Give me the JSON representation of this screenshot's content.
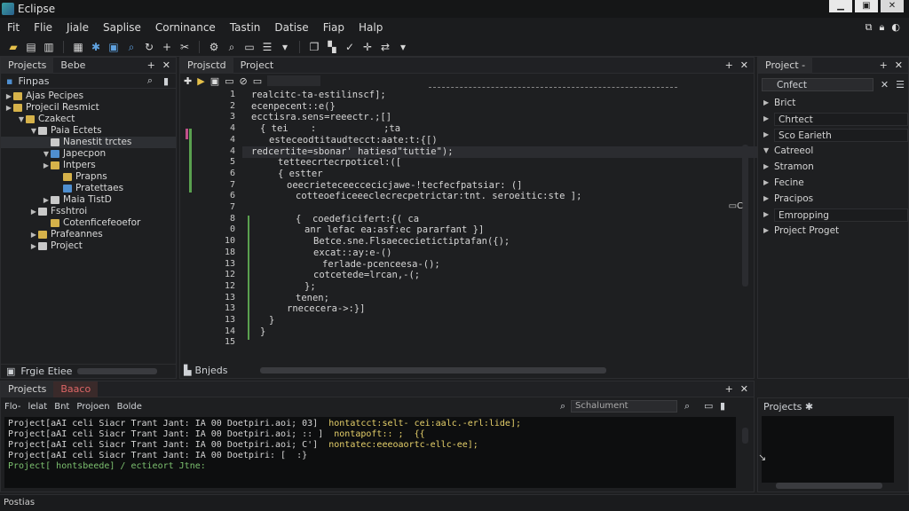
{
  "window": {
    "title": "Eclipse"
  },
  "menu": [
    "Fit",
    "Flie",
    "Jiale",
    "Saplise",
    "Corninance",
    "Tastin",
    "Datise",
    "Fiap",
    "Halp"
  ],
  "toolbar_icons": [
    "new-file-icon",
    "copy-icon",
    "paste-icon",
    "save-icon",
    "debug-icon",
    "run-icon",
    "search-icon",
    "refresh-icon",
    "add-icon",
    "cut-icon",
    "build-icon",
    "find-icon",
    "terminal-icon",
    "menu-icon",
    "window-icon",
    "tile-icon",
    "check-icon",
    "plus-icon",
    "arrows-icon",
    "dropdown-icon"
  ],
  "left_panel": {
    "tab_projects": "Projects",
    "tab_beb": "Bebe",
    "filter_label": "Finpas",
    "tree": [
      {
        "label": "Ajas Pecipes",
        "level": 0,
        "arrow": "▶",
        "icon": "folder",
        "selected": false
      },
      {
        "label": "Projecil Resmict",
        "level": 0,
        "arrow": "▶",
        "icon": "folder",
        "selected": false
      },
      {
        "label": "Czakect",
        "level": 1,
        "arrow": "▼",
        "icon": "folder",
        "selected": false
      },
      {
        "label": "Paia Ectets",
        "level": 2,
        "arrow": "▼",
        "icon": "file",
        "selected": false
      },
      {
        "label": "Nanestit trctes",
        "level": 3,
        "arrow": "",
        "icon": "file",
        "selected": true
      },
      {
        "label": "Japecpon",
        "level": 3,
        "arrow": "▼",
        "icon": "blue",
        "selected": false
      },
      {
        "label": "Intpers",
        "level": 3,
        "arrow": "▶",
        "icon": "folder",
        "selected": false
      },
      {
        "label": "Prapns",
        "level": 4,
        "arrow": "",
        "icon": "folder",
        "selected": false
      },
      {
        "label": "Pratettaes",
        "level": 4,
        "arrow": "",
        "icon": "blue",
        "selected": false
      },
      {
        "label": "Maia TistD",
        "level": 3,
        "arrow": "▶",
        "icon": "file",
        "selected": false
      },
      {
        "label": "Fsshtroi",
        "level": 2,
        "arrow": "▶",
        "icon": "file",
        "selected": false
      },
      {
        "label": "Cotenficefeoefor",
        "level": 3,
        "arrow": "",
        "icon": "folder",
        "selected": false
      },
      {
        "label": "Prafeannes",
        "level": 2,
        "arrow": "▶",
        "icon": "folder",
        "selected": false
      },
      {
        "label": "Project",
        "level": 2,
        "arrow": "▶",
        "icon": "file",
        "selected": false
      }
    ],
    "footer_label": "Frgie Etiee"
  },
  "editor": {
    "tab_active": "Projsctd",
    "tab_other": "Project",
    "lines": [
      {
        "n": "1",
        "text": "realcitc-ta-estilinscf];",
        "hl": false,
        "indent": 0
      },
      {
        "n": "2",
        "text": "ecenpecent::e(}",
        "hl": false,
        "indent": 0
      },
      {
        "n": "3",
        "text": "ecctisra.sens=reeectr.;[]",
        "hl": false,
        "indent": 0
      },
      {
        "n": "4",
        "text": "{ tei    :            ;ta",
        "hl": false,
        "indent": 1
      },
      {
        "n": "4",
        "text": "esteceodtitaudtecct:aate:t:{[)",
        "hl": false,
        "indent": 2
      },
      {
        "n": "4",
        "text": "redcertite=sbonar' hatiesd\"tuttie\");",
        "hl": true,
        "indent": 3
      },
      {
        "n": "5",
        "text": "tetteecrtecrpoticel:([",
        "hl": false,
        "indent": 3
      },
      {
        "n": "6",
        "text": "{ estter",
        "hl": false,
        "indent": 3
      },
      {
        "n": "7",
        "text": "oeecrieteceeccecicjawe-!tecfecfpatsiar: (]",
        "hl": false,
        "indent": 4
      },
      {
        "n": "6",
        "text": "cotteoeficeeeclecrecpetrictar:tnt. seroeitic:ste ];",
        "hl": false,
        "indent": 5
      },
      {
        "n": "7",
        "text": "",
        "hl": false,
        "indent": 0
      },
      {
        "n": "8",
        "text": "{  coedeficifert:{( ca",
        "hl": false,
        "indent": 5
      },
      {
        "n": "0",
        "text": "anr lefac ea:asf:ec pararfant }]",
        "hl": false,
        "indent": 6
      },
      {
        "n": "10",
        "text": "Betce.sne.Flsaececietictiptafan({);",
        "hl": false,
        "indent": 7
      },
      {
        "n": "18",
        "text": "excat::ay:e-()",
        "hl": false,
        "indent": 7
      },
      {
        "n": "13",
        "text": "ferlade-pcenceesa-();",
        "hl": false,
        "indent": 8
      },
      {
        "n": "12",
        "text": "cotcetede=lrcan,-(;",
        "hl": false,
        "indent": 7
      },
      {
        "n": "12",
        "text": "};",
        "hl": false,
        "indent": 6
      },
      {
        "n": "13",
        "text": "tenen;",
        "hl": false,
        "indent": 5
      },
      {
        "n": "13",
        "text": "rnececera->:}]",
        "hl": false,
        "indent": 4
      },
      {
        "n": "13",
        "text": "}",
        "hl": false,
        "indent": 2
      },
      {
        "n": "14",
        "text": "}",
        "hl": false,
        "indent": 1
      },
      {
        "n": "15",
        "text": "",
        "hl": false,
        "indent": 0
      }
    ],
    "bottom_label": "Bnjeds"
  },
  "right_panel": {
    "tab_label": "Project",
    "search_value": "Cnfect",
    "nodes": [
      {
        "label": "Brict",
        "arrow": "▶",
        "boxed": false
      },
      {
        "label": "Chrtect",
        "arrow": "▶",
        "boxed": true
      },
      {
        "label": "Sco Earieth",
        "arrow": "▶",
        "boxed": true
      },
      {
        "label": "Catreeol",
        "arrow": "▼",
        "boxed": false
      },
      {
        "label": "Stramon",
        "arrow": "▶",
        "boxed": false
      },
      {
        "label": "Fecine",
        "arrow": "▶",
        "boxed": false
      },
      {
        "label": "Pracipos",
        "arrow": "▶",
        "boxed": false
      },
      {
        "label": "Emropping",
        "arrow": "▶",
        "boxed": true
      },
      {
        "label": "Project Proget",
        "arrow": "▶",
        "boxed": false
      }
    ],
    "bottom_tab": "Projects"
  },
  "console_panel": {
    "tab_projects": "Projects",
    "tab_second": "Baaco",
    "toolbar_items": [
      "Flo-",
      "lelat",
      "Bnt",
      "Projoen",
      "Bolde"
    ],
    "search_placeholder": "Schalument",
    "rows": [
      {
        "a": "Project[aAI celi Siacr Trant Jant: IA 00 Doetpiri.aoi; 03]",
        "b": "hontatcct:selt- cei:aalc.-erl:lide];"
      },
      {
        "a": "Project[aAI celi Siacr Trant Jant: IA 00 Doetpiri.aoi; :: ]",
        "b": "nontapoft:: ;  {{"
      },
      {
        "a": "Project[aAI celi Siacr Trant Jant: IA 00 Doetpiri.aoi; C']",
        "b": "nontatec:eeeoaortc-ellc-ee];"
      },
      {
        "a": "Project[aAI celi Siacr Trant Jant: IA 00 Doetpiri: [  :}",
        "b": ""
      },
      {
        "a": "Project[ hontsbeede] / ectieort Jtne:",
        "b": ""
      }
    ]
  },
  "statusbar": {
    "text": "Postias"
  }
}
